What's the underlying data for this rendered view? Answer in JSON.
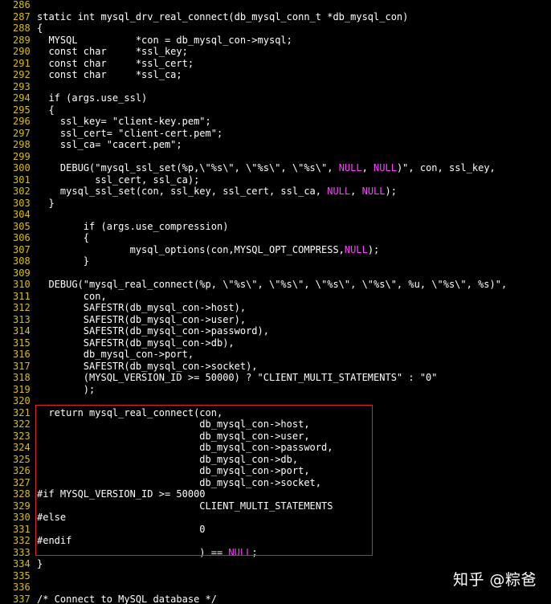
{
  "editor": {
    "background": "#000000",
    "text_color": "#ffffff",
    "line_number_color": "#d8c000",
    "null_color": "#ff40ff",
    "highlight_box_color": "#e0202a"
  },
  "watermark": "知乎 @粽爸",
  "lines": [
    {
      "n": "286",
      "segs": [
        ""
      ]
    },
    {
      "n": "287",
      "segs": [
        "static int mysql_drv_real_connect(db_mysql_conn_t *db_mysql_con)"
      ]
    },
    {
      "n": "288",
      "segs": [
        "{"
      ]
    },
    {
      "n": "289",
      "segs": [
        "  MYSQL          *con = db_mysql_con->mysql;"
      ]
    },
    {
      "n": "290",
      "segs": [
        "  const char     *ssl_key;"
      ]
    },
    {
      "n": "291",
      "segs": [
        "  const char     *ssl_cert;"
      ]
    },
    {
      "n": "292",
      "segs": [
        "  const char     *ssl_ca;"
      ]
    },
    {
      "n": "293",
      "segs": [
        ""
      ]
    },
    {
      "n": "294",
      "segs": [
        "  if (args.use_ssl)"
      ]
    },
    {
      "n": "295",
      "segs": [
        "  {"
      ]
    },
    {
      "n": "296",
      "segs": [
        "    ssl_key= \"client-key.pem\";"
      ]
    },
    {
      "n": "297",
      "segs": [
        "    ssl_cert= \"client-cert.pem\";"
      ]
    },
    {
      "n": "298",
      "segs": [
        "    ssl_ca= \"cacert.pem\";"
      ]
    },
    {
      "n": "299",
      "segs": [
        ""
      ]
    },
    {
      "n": "300",
      "segs": [
        "    DEBUG(\"mysql_ssl_set(%p,\\\"%s\\\", \\\"%s\\\", \\\"%s\\\", ",
        {
          "t": "NULL",
          "hl": true
        },
        ", ",
        {
          "t": "NULL",
          "hl": true
        },
        ")\", con, ssl_key,"
      ]
    },
    {
      "n": "301",
      "segs": [
        "          ssl_cert, ssl_ca);"
      ]
    },
    {
      "n": "302",
      "segs": [
        "    mysql_ssl_set(con, ssl_key, ssl_cert, ssl_ca, ",
        {
          "t": "NULL",
          "hl": true
        },
        ", ",
        {
          "t": "NULL",
          "hl": true
        },
        ");"
      ]
    },
    {
      "n": "303",
      "segs": [
        "  }"
      ]
    },
    {
      "n": "304",
      "segs": [
        ""
      ]
    },
    {
      "n": "305",
      "segs": [
        "        if (args.use_compression)"
      ]
    },
    {
      "n": "306",
      "segs": [
        "        {"
      ]
    },
    {
      "n": "307",
      "segs": [
        "                mysql_options(con,MYSQL_OPT_COMPRESS,",
        {
          "t": "NULL",
          "hl": true
        },
        ");"
      ]
    },
    {
      "n": "308",
      "segs": [
        "        }"
      ]
    },
    {
      "n": "309",
      "segs": [
        ""
      ]
    },
    {
      "n": "310",
      "segs": [
        "  DEBUG(\"mysql_real_connect(%p, \\\"%s\\\", \\\"%s\\\", \\\"%s\\\", \\\"%s\\\", %u, \\\"%s\\\", %s)\","
      ]
    },
    {
      "n": "311",
      "segs": [
        "        con,"
      ]
    },
    {
      "n": "312",
      "segs": [
        "        SAFESTR(db_mysql_con->host),"
      ]
    },
    {
      "n": "313",
      "segs": [
        "        SAFESTR(db_mysql_con->user),"
      ]
    },
    {
      "n": "314",
      "segs": [
        "        SAFESTR(db_mysql_con->password),"
      ]
    },
    {
      "n": "315",
      "segs": [
        "        SAFESTR(db_mysql_con->db),"
      ]
    },
    {
      "n": "316",
      "segs": [
        "        db_mysql_con->port,"
      ]
    },
    {
      "n": "317",
      "segs": [
        "        SAFESTR(db_mysql_con->socket),"
      ]
    },
    {
      "n": "318",
      "segs": [
        "        (MYSQL_VERSION_ID >= 50000) ? \"CLIENT_MULTI_STATEMENTS\" : \"0\""
      ]
    },
    {
      "n": "319",
      "segs": [
        "        );"
      ]
    },
    {
      "n": "320",
      "segs": [
        ""
      ]
    },
    {
      "n": "321",
      "segs": [
        "  return mysql_real_connect(con,"
      ]
    },
    {
      "n": "322",
      "segs": [
        "                            db_mysql_con->host,"
      ]
    },
    {
      "n": "323",
      "segs": [
        "                            db_mysql_con->user,"
      ]
    },
    {
      "n": "324",
      "segs": [
        "                            db_mysql_con->password,"
      ]
    },
    {
      "n": "325",
      "segs": [
        "                            db_mysql_con->db,"
      ]
    },
    {
      "n": "326",
      "segs": [
        "                            db_mysql_con->port,"
      ]
    },
    {
      "n": "327",
      "segs": [
        "                            db_mysql_con->socket,"
      ]
    },
    {
      "n": "328",
      "segs": [
        "#if MYSQL_VERSION_ID >= 50000"
      ]
    },
    {
      "n": "329",
      "segs": [
        "                            CLIENT_MULTI_STATEMENTS"
      ]
    },
    {
      "n": "330",
      "segs": [
        "#else"
      ]
    },
    {
      "n": "331",
      "segs": [
        "                            0"
      ]
    },
    {
      "n": "332",
      "segs": [
        "#endif"
      ]
    },
    {
      "n": "333",
      "segs": [
        "                            ) == ",
        {
          "t": "NULL",
          "hl": true
        },
        ";"
      ]
    },
    {
      "n": "334",
      "segs": [
        "}"
      ]
    },
    {
      "n": "335",
      "segs": [
        ""
      ]
    },
    {
      "n": "336",
      "segs": [
        ""
      ]
    },
    {
      "n": "337",
      "segs": [
        "/* Connect to MySQL database */"
      ]
    }
  ]
}
